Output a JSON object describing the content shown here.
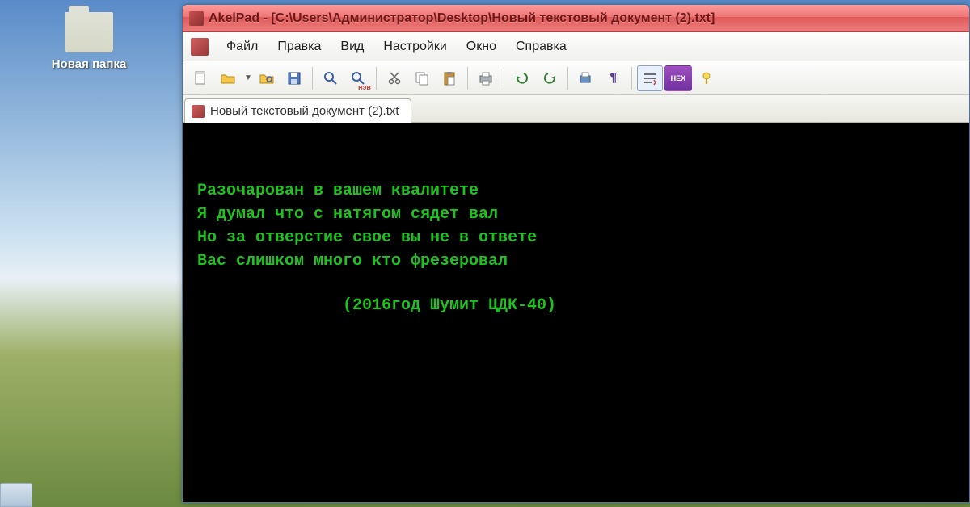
{
  "desktop": {
    "folder_label": "Новая папка"
  },
  "window": {
    "title": "AkelPad - [C:\\Users\\Администратор\\Desktop\\Новый текстовый документ (2).txt]"
  },
  "menu": {
    "file": "Файл",
    "edit": "Правка",
    "view": "Вид",
    "settings": "Настройки",
    "window": "Окно",
    "help": "Справка"
  },
  "tab": {
    "label": "Новый текстовый документ (2).txt"
  },
  "editor": {
    "line1": "Разочарован в вашем квалитете",
    "line2": "Я думал что с натягом сядет вал",
    "line3": "Но за отверстие свое вы не в ответе",
    "line4": "Вас слишком много кто фрезеровал",
    "signature": "(2016год Шумит ЦДК-40)"
  },
  "icons": {
    "search_label": "нэв",
    "hex_label": "HEX"
  }
}
